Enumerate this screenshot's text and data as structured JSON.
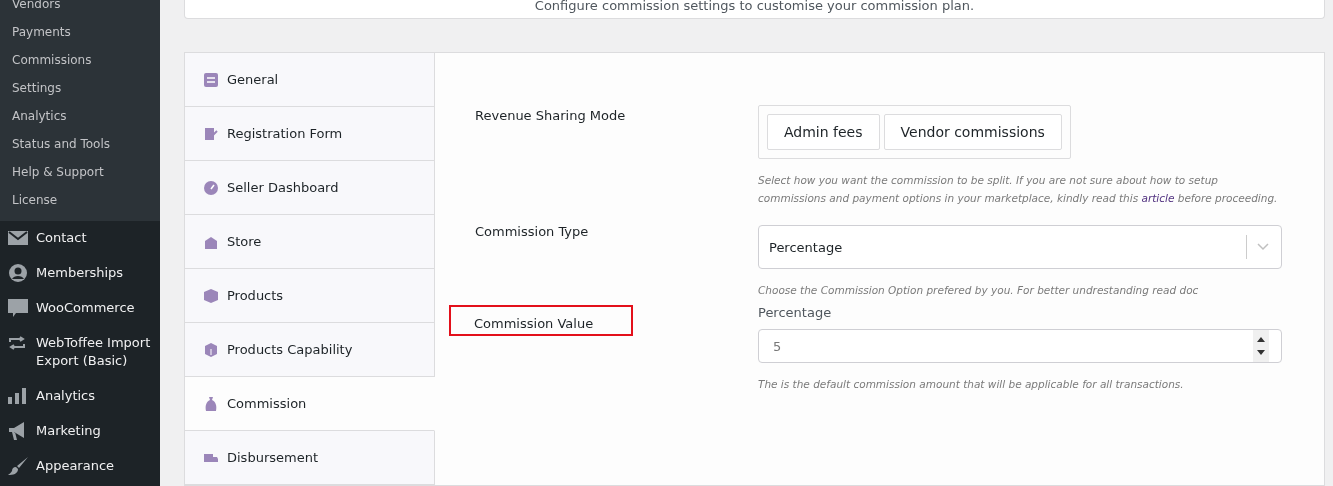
{
  "sidebar": {
    "submenu": [
      {
        "label": "Vendors"
      },
      {
        "label": "Payments"
      },
      {
        "label": "Commissions"
      },
      {
        "label": "Settings"
      },
      {
        "label": "Analytics"
      },
      {
        "label": "Status and Tools"
      },
      {
        "label": "Help & Support"
      },
      {
        "label": "License"
      }
    ],
    "menu": [
      {
        "label": "Contact",
        "kind": "mail"
      },
      {
        "label": "Memberships",
        "kind": "person"
      },
      {
        "label": "WooCommerce",
        "kind": "woo"
      },
      {
        "label": "WebToffee Import Export (Basic)",
        "kind": "arrows"
      },
      {
        "label": "Analytics",
        "kind": "bars"
      },
      {
        "label": "Marketing",
        "kind": "megaphone"
      },
      {
        "label": "Appearance",
        "kind": "brush"
      }
    ]
  },
  "header": {
    "subtitle": "Configure commission settings to customise your commission plan."
  },
  "tabs": [
    {
      "label": "General",
      "kind": "sliders",
      "selected": false
    },
    {
      "label": "Registration Form",
      "kind": "form",
      "selected": false
    },
    {
      "label": "Seller Dashboard",
      "kind": "gauge",
      "selected": false
    },
    {
      "label": "Store",
      "kind": "store",
      "selected": false
    },
    {
      "label": "Products",
      "kind": "box",
      "selected": false
    },
    {
      "label": "Products Capability",
      "kind": "box2",
      "selected": false
    },
    {
      "label": "Commission",
      "kind": "bag",
      "selected": true
    },
    {
      "label": "Disbursement",
      "kind": "truck",
      "selected": false
    }
  ],
  "fields": [
    {
      "label": "Revenue Sharing Mode",
      "kind": "toggle",
      "highlighted": false,
      "options": [
        {
          "label": "Admin fees",
          "selected": false
        },
        {
          "label": "Vendor commissions",
          "selected": false
        }
      ],
      "help": "Select how you want the commission to be split. If you are not sure about how to setup commissions and payment options in your marketplace, kindly read this ",
      "link": "article",
      "help_after": " before proceeding."
    },
    {
      "label": "Commission Type",
      "kind": "select",
      "highlighted": false,
      "value": "Percentage",
      "help": "Choose the Commission Option prefered by you. For better undrestanding read doc"
    },
    {
      "label": "Commission Value",
      "kind": "number",
      "highlighted": true,
      "sublabel": "Percentage",
      "value": "5",
      "help": "The is the default commission amount that will be applicable for all transactions."
    }
  ]
}
